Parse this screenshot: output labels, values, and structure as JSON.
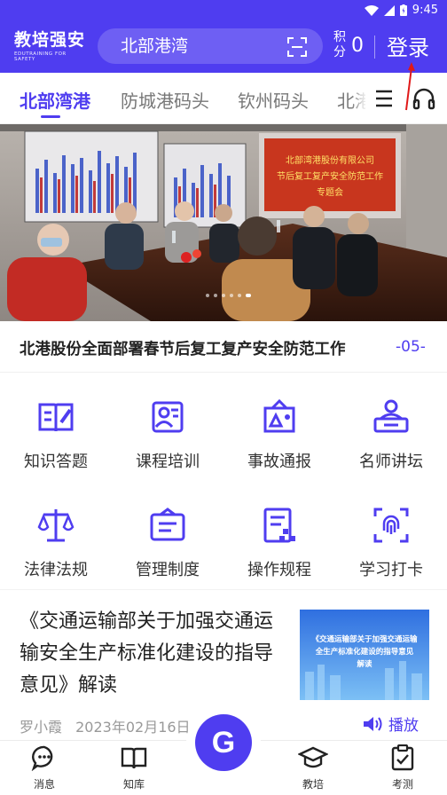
{
  "status_bar": {
    "time": "9:45"
  },
  "header": {
    "logo_cn": "教培强安",
    "logo_en": "EDUTRAINING FOR SAFETY",
    "search_value": "北部港湾",
    "points_label": "积分",
    "points_value": "0",
    "login_label": "登录"
  },
  "tabs": [
    {
      "label": "北部湾港",
      "active": true
    },
    {
      "label": "防城港码头",
      "active": false
    },
    {
      "label": "钦州码头",
      "active": false
    },
    {
      "label": "北港",
      "active": false
    }
  ],
  "banner": {
    "sign_line1": "北部湾港股份有限公司",
    "sign_line2": "节后复工复产安全防范工作",
    "sign_line3": "专题会",
    "slide_count": 6,
    "active_slide": 5
  },
  "headline": {
    "text": "北港股份全面部署春节后复工复产安全防范工作",
    "date": "-05-"
  },
  "grid": [
    {
      "label": "知识答题",
      "icon": "quiz-book-icon"
    },
    {
      "label": "课程培训",
      "icon": "course-training-icon"
    },
    {
      "label": "事故通报",
      "icon": "accident-report-icon"
    },
    {
      "label": "名师讲坛",
      "icon": "teacher-lecture-icon"
    },
    {
      "label": "法律法规",
      "icon": "law-scale-icon"
    },
    {
      "label": "管理制度",
      "icon": "management-system-icon"
    },
    {
      "label": "操作规程",
      "icon": "operation-procedure-icon"
    },
    {
      "label": "学习打卡",
      "icon": "fingerprint-checkin-icon"
    }
  ],
  "article": {
    "title": "《交通运输部关于加强交通运输安全生产标准化建设的指导意见》解读",
    "thumb_line1": "《交通运输部关于加强交通运输",
    "thumb_line2": "全生产标准化建设的指导意见",
    "thumb_line3": "解读",
    "author": "罗小霞",
    "date": "2023年02月16日",
    "extra": "3",
    "play_label": "播放"
  },
  "bottom_nav": [
    {
      "label": "消息",
      "icon": "message-icon"
    },
    {
      "label": "知库",
      "icon": "book-library-icon"
    },
    {
      "label": "教培",
      "icon": "graduation-cap-icon"
    },
    {
      "label": "考测",
      "icon": "exam-clipboard-icon"
    }
  ],
  "fab": {
    "label": "G"
  },
  "colors": {
    "brand": "#4f3df0",
    "search_bg": "#6e5ff3"
  }
}
